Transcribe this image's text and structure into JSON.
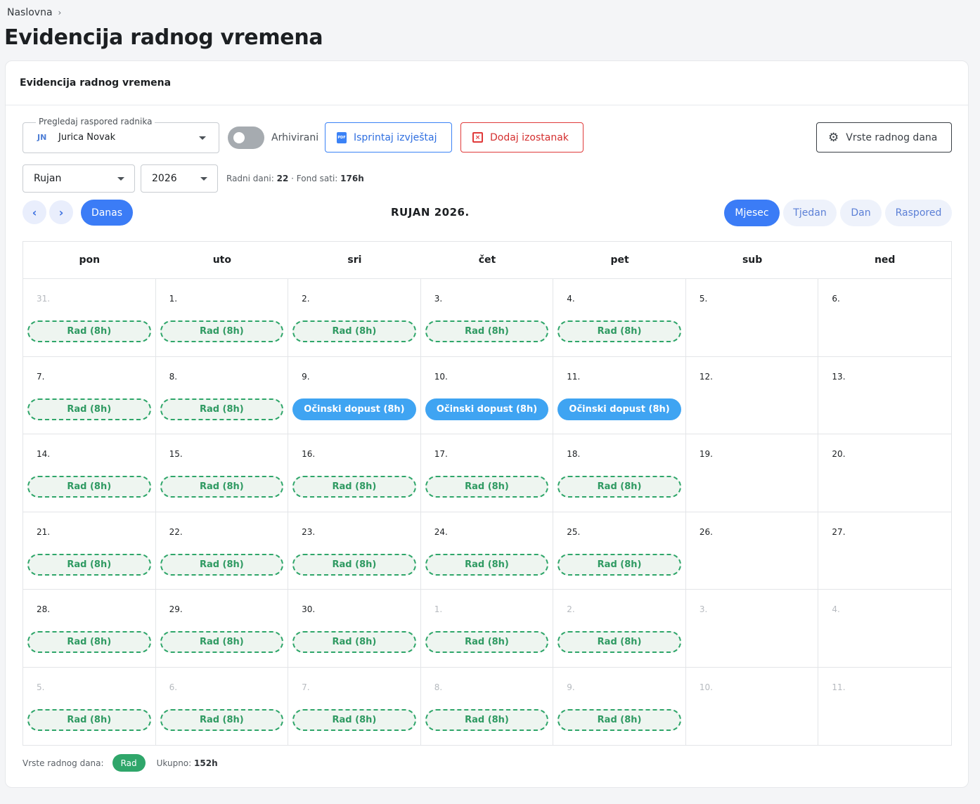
{
  "breadcrumb": {
    "home": "Naslovna"
  },
  "page_title": "Evidencija radnog vremena",
  "card_title": "Evidencija radnog vremena",
  "employee_select": {
    "legend": "Pregledaj raspored radnika",
    "initials": "JN",
    "name": "Jurica Novak"
  },
  "archived_toggle": {
    "label": "Arhivirani",
    "on": false
  },
  "buttons": {
    "print": "Isprintaj izvještaj",
    "add_absence": "Dodaj izostanak",
    "day_types": "Vrste radnog dana"
  },
  "month_select": {
    "value": "Rujan"
  },
  "year_select": {
    "value": "2026"
  },
  "stats": {
    "work_days_label": "Radni dani:",
    "work_days": "22",
    "sep": "·",
    "fund_label": "Fond sati:",
    "fund": "176h"
  },
  "nav": {
    "today": "Danas",
    "period_title": "RUJAN 2026."
  },
  "view_tabs": {
    "month": "Mjesec",
    "week": "Tjedan",
    "day": "Dan",
    "schedule": "Raspored",
    "active": "month"
  },
  "weekdays": [
    "pon",
    "uto",
    "sri",
    "čet",
    "pet",
    "sub",
    "ned"
  ],
  "calendar": [
    {
      "day": "31.",
      "out": true,
      "event": "Rad (8h)",
      "type": "work"
    },
    {
      "day": "1.",
      "out": false,
      "event": "Rad (8h)",
      "type": "work"
    },
    {
      "day": "2.",
      "out": false,
      "event": "Rad (8h)",
      "type": "work"
    },
    {
      "day": "3.",
      "out": false,
      "event": "Rad (8h)",
      "type": "work"
    },
    {
      "day": "4.",
      "out": false,
      "event": "Rad (8h)",
      "type": "work"
    },
    {
      "day": "5.",
      "out": false,
      "event": "",
      "type": ""
    },
    {
      "day": "6.",
      "out": false,
      "event": "",
      "type": ""
    },
    {
      "day": "7.",
      "out": false,
      "event": "Rad (8h)",
      "type": "work"
    },
    {
      "day": "8.",
      "out": false,
      "event": "Rad (8h)",
      "type": "work"
    },
    {
      "day": "9.",
      "out": false,
      "event": "Očinski dopust (8h)",
      "type": "leave"
    },
    {
      "day": "10.",
      "out": false,
      "event": "Očinski dopust (8h)",
      "type": "leave"
    },
    {
      "day": "11.",
      "out": false,
      "event": "Očinski dopust (8h)",
      "type": "leave"
    },
    {
      "day": "12.",
      "out": false,
      "event": "",
      "type": ""
    },
    {
      "day": "13.",
      "out": false,
      "event": "",
      "type": ""
    },
    {
      "day": "14.",
      "out": false,
      "event": "Rad (8h)",
      "type": "work"
    },
    {
      "day": "15.",
      "out": false,
      "event": "Rad (8h)",
      "type": "work"
    },
    {
      "day": "16.",
      "out": false,
      "event": "Rad (8h)",
      "type": "work"
    },
    {
      "day": "17.",
      "out": false,
      "event": "Rad (8h)",
      "type": "work"
    },
    {
      "day": "18.",
      "out": false,
      "event": "Rad (8h)",
      "type": "work"
    },
    {
      "day": "19.",
      "out": false,
      "event": "",
      "type": ""
    },
    {
      "day": "20.",
      "out": false,
      "event": "",
      "type": ""
    },
    {
      "day": "21.",
      "out": false,
      "event": "Rad (8h)",
      "type": "work"
    },
    {
      "day": "22.",
      "out": false,
      "event": "Rad (8h)",
      "type": "work"
    },
    {
      "day": "23.",
      "out": false,
      "event": "Rad (8h)",
      "type": "work"
    },
    {
      "day": "24.",
      "out": false,
      "event": "Rad (8h)",
      "type": "work"
    },
    {
      "day": "25.",
      "out": false,
      "event": "Rad (8h)",
      "type": "work"
    },
    {
      "day": "26.",
      "out": false,
      "event": "",
      "type": ""
    },
    {
      "day": "27.",
      "out": false,
      "event": "",
      "type": ""
    },
    {
      "day": "28.",
      "out": false,
      "event": "Rad (8h)",
      "type": "work"
    },
    {
      "day": "29.",
      "out": false,
      "event": "Rad (8h)",
      "type": "work"
    },
    {
      "day": "30.",
      "out": false,
      "event": "Rad (8h)",
      "type": "work"
    },
    {
      "day": "1.",
      "out": true,
      "event": "Rad (8h)",
      "type": "work"
    },
    {
      "day": "2.",
      "out": true,
      "event": "Rad (8h)",
      "type": "work"
    },
    {
      "day": "3.",
      "out": true,
      "event": "",
      "type": ""
    },
    {
      "day": "4.",
      "out": true,
      "event": "",
      "type": ""
    },
    {
      "day": "5.",
      "out": true,
      "event": "Rad (8h)",
      "type": "work"
    },
    {
      "day": "6.",
      "out": true,
      "event": "Rad (8h)",
      "type": "work"
    },
    {
      "day": "7.",
      "out": true,
      "event": "Rad (8h)",
      "type": "work"
    },
    {
      "day": "8.",
      "out": true,
      "event": "Rad (8h)",
      "type": "work"
    },
    {
      "day": "9.",
      "out": true,
      "event": "Rad (8h)",
      "type": "work"
    },
    {
      "day": "10.",
      "out": true,
      "event": "",
      "type": ""
    },
    {
      "day": "11.",
      "out": true,
      "event": "",
      "type": ""
    }
  ],
  "footer": {
    "legend_label": "Vrste radnog dana:",
    "chip": "Rad",
    "total_label": "Ukupno:",
    "total": "152h"
  },
  "colors": {
    "primary": "#3b7cf6",
    "work": "#2fa66a",
    "leave": "#3fa4f2",
    "danger": "#e03a3a"
  }
}
